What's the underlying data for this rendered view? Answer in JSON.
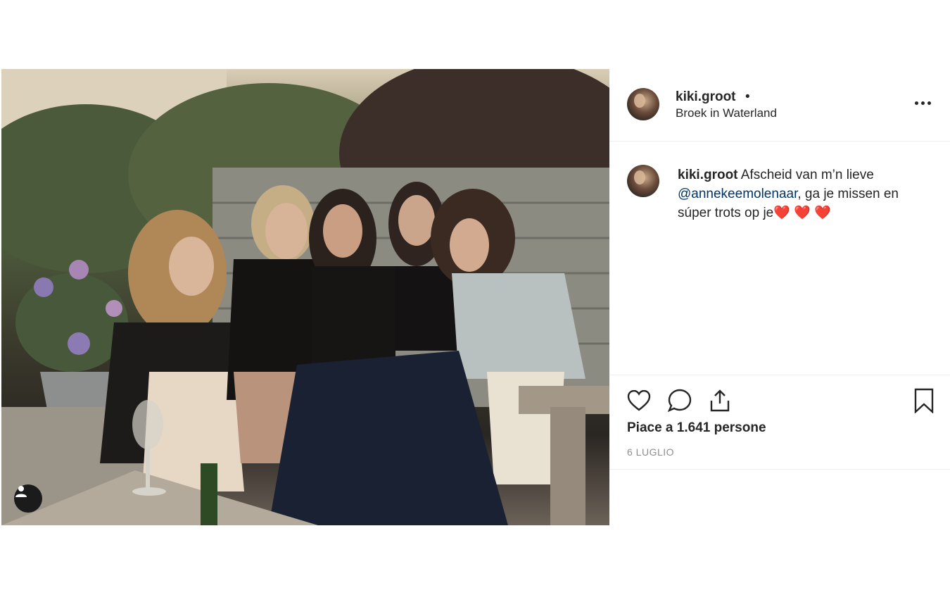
{
  "post": {
    "photo_alt": "Five women sitting together on a wooden bench in a garden",
    "username": "kiki.groot",
    "header_separator": "•",
    "location": "Broek in Waterland",
    "caption": {
      "username": "kiki.groot",
      "text_before": "Afscheid van m’n lieve ",
      "mention": "@annekeemolenaar",
      "text_after": ", ga je missen en súper trots op je",
      "emojis": "❤️ ❤️ ❤️"
    },
    "likes": "Piace a 1.641 persone",
    "date": "6 LUGLIO"
  },
  "icons": {
    "more": "more-options-icon",
    "like": "heart-icon",
    "comment": "comment-icon",
    "share": "share-icon",
    "save": "bookmark-icon",
    "tags": "user-tag-icon"
  }
}
